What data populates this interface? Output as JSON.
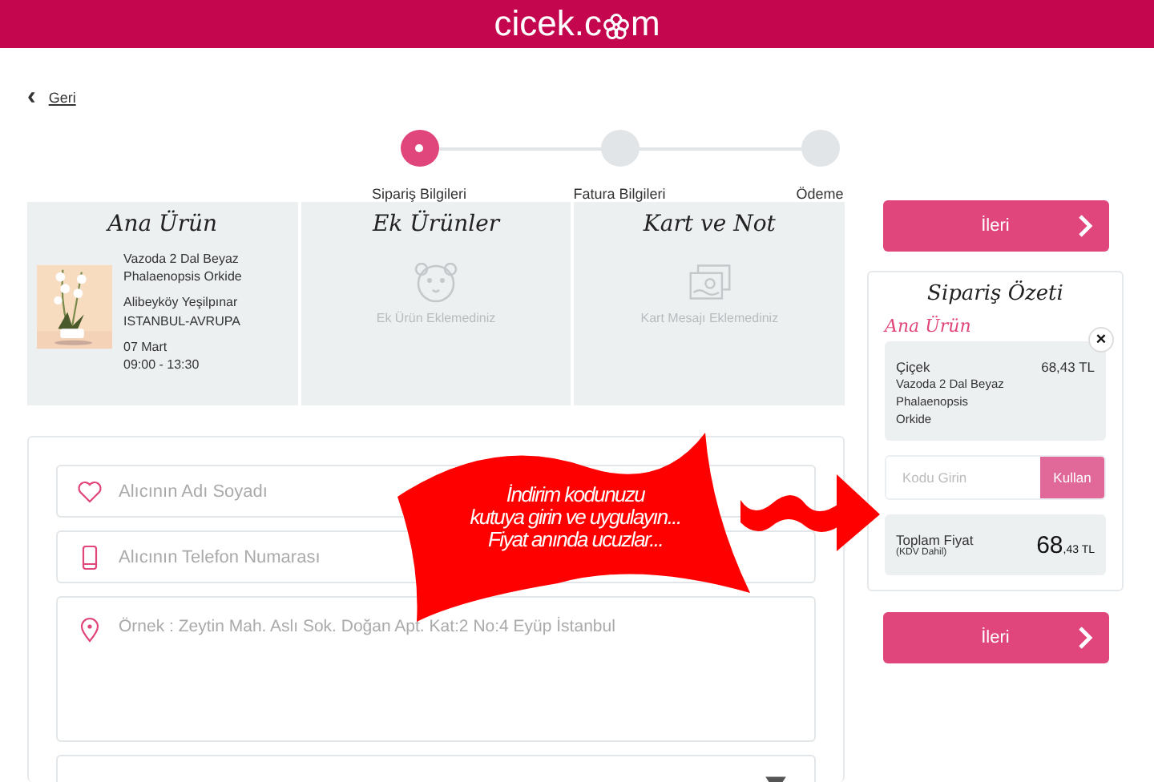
{
  "header": {
    "logo": "cicek.c",
    "logo_tail": "m"
  },
  "back_link": {
    "icon": "‹",
    "label": "Geri"
  },
  "steps": [
    {
      "label": "Sipariş Bilgileri",
      "selected": true
    },
    {
      "label": "Fatura Bilgileri",
      "selected": false
    },
    {
      "label": "Ödeme",
      "selected": false
    }
  ],
  "order_panels": [
    {
      "kind": "product",
      "title": "Ana Ürün",
      "product_name": "Vazoda 2 Dal Beyaz Phalaenopsis Orkide",
      "address": [
        "Alibeyköy Yeşilpınar",
        "ISTANBUL-AVRUPA"
      ],
      "delivery": [
        "07 Mart",
        "09:00 - 13:30"
      ]
    },
    {
      "kind": "extras",
      "title": "Ek Ürünler",
      "empty_text": "Ek Ürün Eklemediniz"
    },
    {
      "kind": "card",
      "title": "Kart ve Not",
      "empty_text": "Kart Mesajı Eklemediniz"
    }
  ],
  "form": {
    "fields": [
      {
        "kind": "name",
        "placeholder": "Alıcının Adı Soyadı"
      },
      {
        "kind": "phone",
        "placeholder": "Alıcının Telefon Numarası"
      },
      {
        "kind": "address",
        "placeholder": "Örnek : Zeytin Mah. Aslı Sok. Doğan Apt. Kat:2 No:4 Eyüp İstanbul"
      },
      {
        "kind": "select"
      }
    ]
  },
  "promo_banner": {
    "lines": [
      "İndirim kodunuzu",
      "kutuya girin ve uygulayın...",
      "Fiyat anında ucuzlar..."
    ]
  },
  "next_buttons": [
    "İleri",
    "İleri"
  ],
  "summary": {
    "title": "Sipariş Özeti",
    "section": "Ana Ürün",
    "item": {
      "category": "Çiçek",
      "price": "68,43 TL",
      "name": [
        "Vazoda 2 Dal Beyaz",
        "Phalaenopsis",
        "Orkide"
      ],
      "remove": "×"
    },
    "coupon": {
      "placeholder": "Kodu Girin",
      "button": "Kullan"
    },
    "total": {
      "label": "Toplam Fiyat",
      "note": "(KDV Dahil)",
      "amount_main": "68",
      "amount_rest": ",43 TL"
    }
  }
}
